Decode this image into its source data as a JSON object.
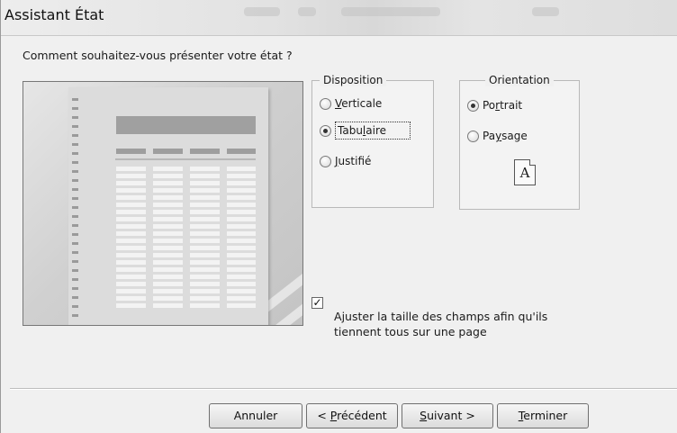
{
  "window": {
    "title": "Assistant État"
  },
  "question": "Comment souhaitez-vous présenter votre état ?",
  "disposition": {
    "legend": "Disposition",
    "options": [
      {
        "pre": "",
        "u": "V",
        "post": "erticale",
        "selected": false
      },
      {
        "pre": "Tabu",
        "u": "l",
        "post": "aire",
        "selected": true
      },
      {
        "pre": "",
        "u": "J",
        "post": "ustifié",
        "selected": false
      }
    ]
  },
  "orientation": {
    "legend": "Orientation",
    "options": [
      {
        "pre": "Po",
        "u": "r",
        "post": "trait",
        "selected": true
      },
      {
        "pre": "Pa",
        "u": "y",
        "post": "sage",
        "selected": false
      }
    ],
    "icon_letter": "A"
  },
  "fit_checkbox": {
    "checked": true,
    "mark": "✓",
    "pre": "A",
    "u": "j",
    "post": "uster la taille des champs afin qu'ils tiennent tous sur une page"
  },
  "buttons": {
    "cancel": "Annuler",
    "previous": {
      "pre": "< ",
      "u": "P",
      "post": "récédent"
    },
    "next": {
      "pre": "",
      "u": "S",
      "post": "uivant >"
    },
    "finish": {
      "pre": "",
      "u": "T",
      "post": "erminer"
    }
  }
}
